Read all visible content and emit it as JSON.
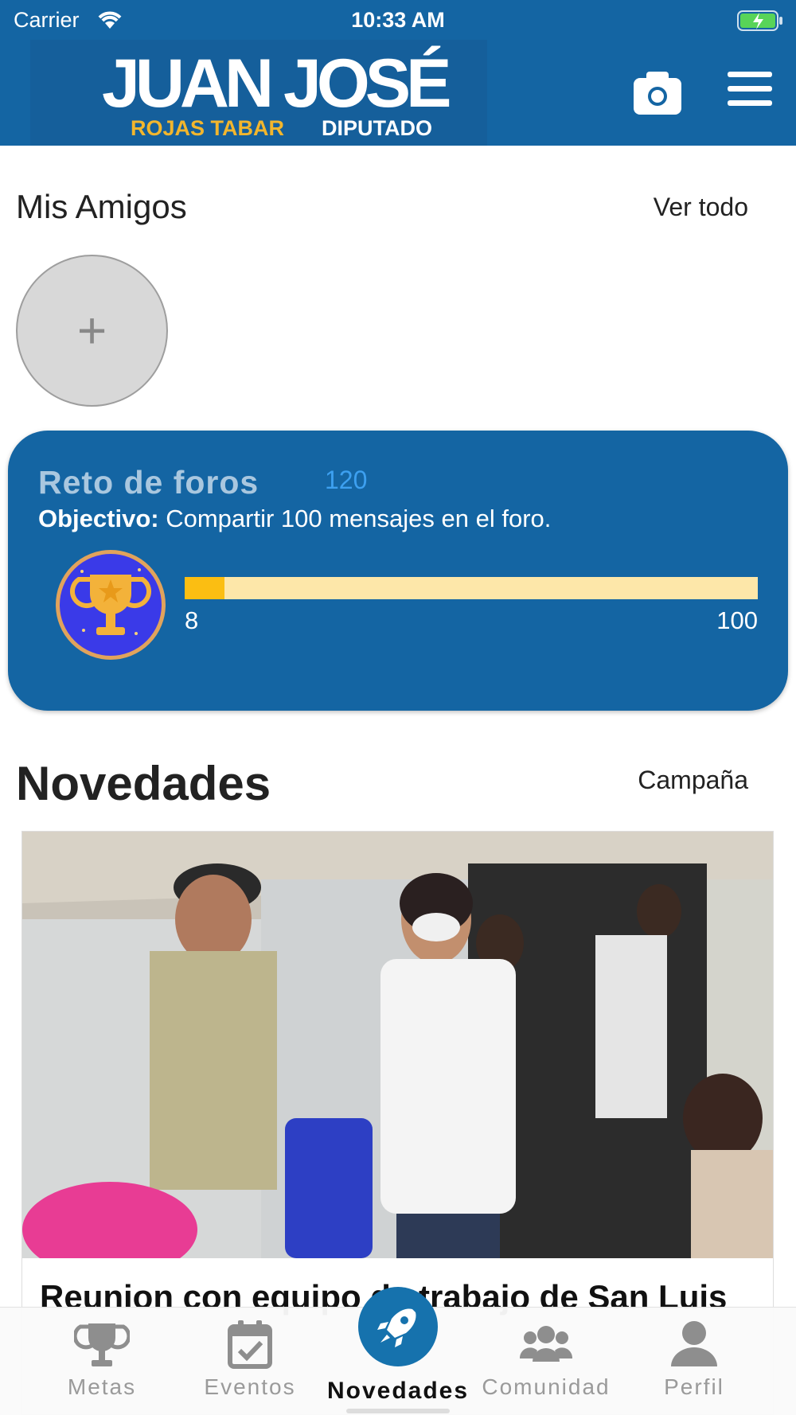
{
  "status_bar": {
    "carrier": "Carrier",
    "time": "10:33 AM"
  },
  "header": {
    "logo_main": "JUAN JOSÉ",
    "logo_sub_left": "ROJAS TABAR",
    "logo_sub_right": "DIPUTADO",
    "camera_icon": "camera-icon",
    "menu_icon": "hamburger-menu-icon"
  },
  "friends": {
    "title": "Mis Amigos",
    "see_all": "Ver todo",
    "add_symbol": "+"
  },
  "challenge": {
    "title": "Reto de foros",
    "score": "120",
    "goal_label": "Objectivo:",
    "goal_text": " Compartir 100 mensajes en el foro.",
    "progress_min": "8",
    "progress_max": "100",
    "progress_value": 0.07,
    "colors": {
      "card": "#1465a3",
      "track": "#fde7a9",
      "fill": "#fbbe12"
    }
  },
  "news": {
    "title": "Novedades",
    "filter": "Campaña",
    "card": {
      "headline": "Reunion con equipo de trabajo de San Luis"
    }
  },
  "tabbar": {
    "tabs": [
      {
        "label": "Metas",
        "icon": "trophy-icon"
      },
      {
        "label": "Eventos",
        "icon": "calendar-check-icon"
      },
      {
        "label": "Novedades",
        "icon": "rocket-icon",
        "active": true
      },
      {
        "label": "Comunidad",
        "icon": "users-icon"
      },
      {
        "label": "Perfil",
        "icon": "user-icon"
      }
    ]
  }
}
